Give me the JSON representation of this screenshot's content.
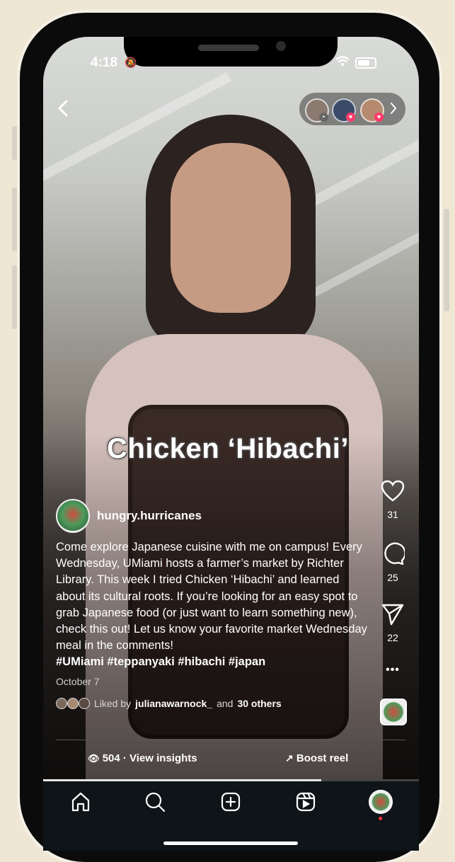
{
  "status_bar": {
    "time": "4:18"
  },
  "viewers": {
    "count_icons": 3
  },
  "video": {
    "overlay_title": "Chicken ‘Hibachi’",
    "progress_fraction": 0.74
  },
  "actions": {
    "likes": "31",
    "comments": "25",
    "shares": "22",
    "more_label": "•••"
  },
  "post": {
    "username": "hungry.hurricanes",
    "caption": "Come explore Japanese cuisine with me on campus! Every Wednesday, UMiami hosts a farmer’s market by Richter Library. This week I tried Chicken ‘Hibachi’ and learned about its cultural roots. If you’re looking for an easy spot to grab Japanese food (or just want to learn something new), check this out! Let us know your favorite market Wednesday meal in the comments!",
    "hashtags": "#UMiami #teppanyaki #hibachi #japan",
    "date": "October 7",
    "liked_prefix": "Liked by",
    "liked_user": "julianawarnock_",
    "liked_and": "and",
    "liked_others": "30 others"
  },
  "insights": {
    "label": "504 · View insights"
  },
  "boost": {
    "label": "Boost reel"
  },
  "icons": [
    "chevron-left-icon",
    "heart-icon",
    "comment-icon",
    "share-icon",
    "more-icon",
    "home-icon",
    "search-icon",
    "create-icon",
    "reels-icon",
    "profile-icon",
    "eye-icon",
    "trend-arrow-icon"
  ]
}
